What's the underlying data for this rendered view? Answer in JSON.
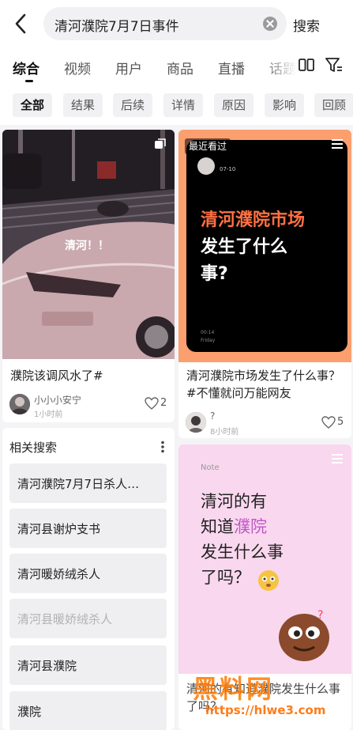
{
  "search": {
    "query": "清河濮院7月7日事件",
    "button": "搜索"
  },
  "tabs": [
    "综合",
    "视频",
    "用户",
    "商品",
    "直播",
    "话题"
  ],
  "chips": [
    "全部",
    "结果",
    "后续",
    "详情",
    "原因",
    "影响",
    "回顾"
  ],
  "icons": {
    "back": "chevron-left-icon",
    "clear": "close-circle-icon",
    "grid": "grid-view-icon",
    "filter": "filter-icon",
    "heart": "heart-icon",
    "more": "more-vertical-icon",
    "multi": "multi-image-icon",
    "menu": "menu-lines-icon"
  },
  "colors": {
    "accent": "#ff6b1a",
    "poster_red": "#ff7042",
    "highlight": "#c057c8"
  },
  "cards": [
    {
      "photo_caption": "清河！！",
      "title": "濮院该调风水了#",
      "author": "小小小安宁",
      "time": "1小时前",
      "likes": "2"
    },
    {
      "recent_badge": "最近看过",
      "poster_date": "07-10",
      "poster_line1": "清河濮院市场",
      "poster_line2": "发生了什么",
      "poster_line3": "事?",
      "poster_time": "00:14",
      "poster_day": "Friday",
      "title": "清河濮院市场发生了什么事？#不懂就问万能网友",
      "author": "?",
      "time": "8小时前",
      "likes": "5"
    },
    {
      "note_label": "Note",
      "line1": "清河的有",
      "line2a": "知道",
      "line2b": "濮院",
      "line3": "发生什么事",
      "line4": "了吗？",
      "title": "清河的有知道濮院发生什么事了吗？"
    }
  ],
  "related": {
    "header": "相关搜索",
    "items": [
      "清河濮院7月7日杀人…",
      "清河县谢炉支书",
      "清河暖娇绒杀人",
      "清河县暖娇绒杀人",
      "清河县濮院",
      "濮院"
    ]
  },
  "watermark": {
    "text": "黑料网",
    "url": "https://hlwe3.com"
  }
}
